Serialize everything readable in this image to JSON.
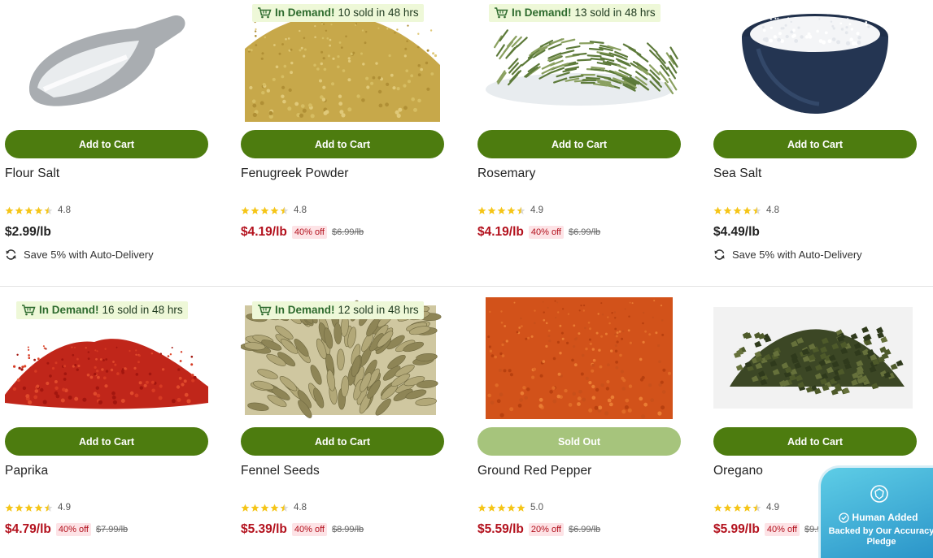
{
  "badge_prefix": "In Demand!",
  "rows": [
    [
      {
        "name": "Flour Salt",
        "cta": "Add to Cart",
        "rating": "4.8",
        "stars": 4.5,
        "price": "$2.99/lb",
        "sale": false,
        "discount": "",
        "was": "",
        "autodelivery": "Save 5% with Auto-Delivery",
        "demand": "",
        "image": "flour-salt-scoop"
      },
      {
        "name": "Fenugreek Powder",
        "cta": "Add to Cart",
        "rating": "4.8",
        "stars": 4.5,
        "price": "$4.19/lb",
        "sale": true,
        "discount": "40% off",
        "was": "$6.99/lb",
        "autodelivery": "",
        "demand": "10 sold in 48 hrs",
        "image": "fenugreek-powder-pile"
      },
      {
        "name": "Rosemary",
        "cta": "Add to Cart",
        "rating": "4.9",
        "stars": 4.5,
        "price": "$4.19/lb",
        "sale": true,
        "discount": "40% off",
        "was": "$6.99/lb",
        "autodelivery": "",
        "demand": "13 sold in 48 hrs",
        "image": "rosemary-leaves"
      },
      {
        "name": "Sea Salt",
        "cta": "Add to Cart",
        "rating": "4.8",
        "stars": 4.5,
        "price": "$4.49/lb",
        "sale": false,
        "discount": "",
        "was": "",
        "autodelivery": "Save 5% with Auto-Delivery",
        "demand": "",
        "image": "sea-salt-bowl"
      }
    ],
    [
      {
        "name": "Paprika",
        "cta": "Add to Cart",
        "rating": "4.9",
        "stars": 4.5,
        "price": "$4.79/lb",
        "sale": true,
        "discount": "40% off",
        "was": "$7.99/lb",
        "autodelivery": "",
        "demand": "16 sold in 48 hrs",
        "image": "paprika-pile"
      },
      {
        "name": "Fennel Seeds",
        "cta": "Add to Cart",
        "rating": "4.8",
        "stars": 4.5,
        "price": "$5.39/lb",
        "sale": true,
        "discount": "40% off",
        "was": "$8.99/lb",
        "autodelivery": "",
        "demand": "12 sold in 48 hrs",
        "image": "fennel-seeds"
      },
      {
        "name": "Ground Red Pepper",
        "cta": "Sold Out",
        "sold_out": true,
        "rating": "5.0",
        "stars": 5,
        "price": "$5.59/lb",
        "sale": true,
        "discount": "20% off",
        "was": "$6.99/lb",
        "autodelivery": "",
        "demand": "",
        "image": "red-pepper-powder"
      },
      {
        "name": "Oregano",
        "cta": "Add to Cart",
        "rating": "4.9",
        "stars": 4.5,
        "price": "$5.99/lb",
        "sale": true,
        "discount": "40% off",
        "was": "$9.99/lb",
        "autodelivery": "",
        "demand": "",
        "image": "oregano-leaves"
      }
    ]
  ],
  "pledge": {
    "title": "Human Added",
    "subtitle": "Backed by Our Accuracy Pledge"
  },
  "colors": {
    "cta": "#4d7c0f",
    "cta_disabled": "#a6c47c",
    "sale_price": "#b3111d",
    "star": "#f5c518"
  }
}
